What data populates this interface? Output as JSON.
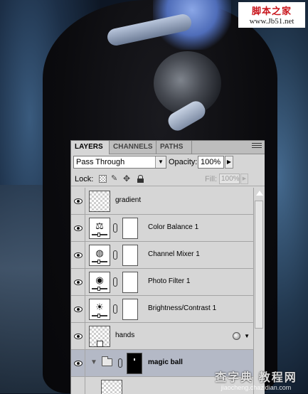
{
  "watermark_top": {
    "title": "脚本之家",
    "url": "www.Jb51.net"
  },
  "watermark_bottom": {
    "site_cn": "查字典 教程网",
    "site_url": "jiaocheng.chazidian.com"
  },
  "panel": {
    "tabs": [
      "LAYERS",
      "CHANNELS",
      "PATHS"
    ],
    "active_tab": "LAYERS",
    "blend_mode": "Pass Through",
    "opacity_label": "Opacity:",
    "opacity_value": "100%",
    "lock_label": "Lock:",
    "fill_label": "Fill:",
    "fill_value": "100%"
  },
  "layers": [
    {
      "name": "gradient",
      "type": "pixel",
      "visible": true
    },
    {
      "name": "Color Balance 1",
      "type": "adjustment",
      "icon": "scales-icon",
      "visible": true
    },
    {
      "name": "Channel Mixer 1",
      "type": "adjustment",
      "icon": "channel-mixer-icon",
      "visible": true
    },
    {
      "name": "Photo Filter 1",
      "type": "adjustment",
      "icon": "photo-filter-icon",
      "visible": true
    },
    {
      "name": "Brightness/Contrast 1",
      "type": "adjustment",
      "icon": "brightness-icon",
      "visible": true
    },
    {
      "name": "hands",
      "type": "smart-object",
      "has_fx": true,
      "visible": true
    },
    {
      "name": "magic ball",
      "type": "group",
      "selected": true,
      "visible": true
    }
  ]
}
